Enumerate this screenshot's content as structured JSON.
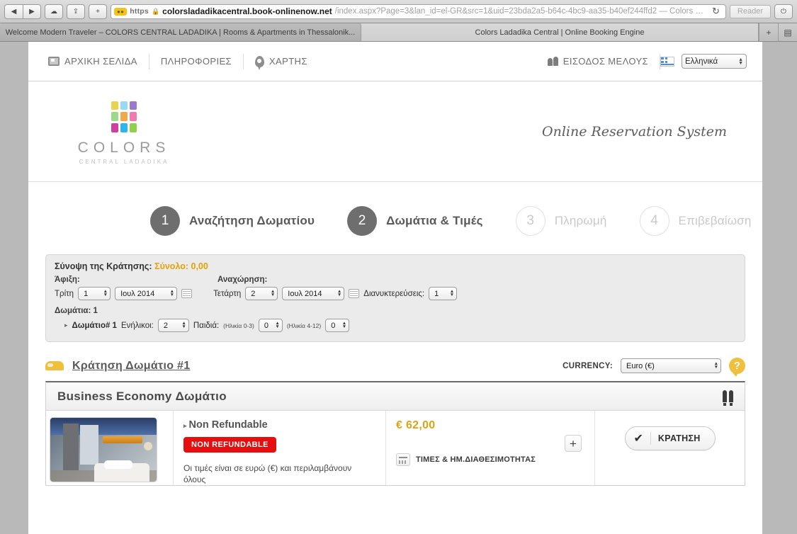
{
  "browser": {
    "back_icon": "◀",
    "forward_icon": "▶",
    "cloud_icon": "☁",
    "share_icon": "⇪",
    "newtab_icon": "+",
    "https_label": "https",
    "lock_icon": "🔒",
    "url_host": "colorsladadikacentral.book-onlinenow.net",
    "url_path": "/index.aspx?Page=3&lan_id=el-GR&src=1&uid=23bda2a5-b64c-4bc9-aa35-b40ef244ffd2 — Colors Ladadika...",
    "reload_icon": "↻",
    "reader_label": "Reader",
    "power_icon": "⏻",
    "tabs": [
      {
        "label": "Welcome Modern Traveler – COLORS CENTRAL LADADIKA | Rooms & Apartments in Thessalonik...",
        "active": false
      },
      {
        "label": "Colors Ladadika Central | Online Booking Engine",
        "active": true
      }
    ],
    "tab_add_icon": "+",
    "tab_list_icon": "▤"
  },
  "topnav": {
    "links": [
      {
        "label": "ΑΡΧΙΚΗ ΣΕΛΙΔΑ",
        "icon": "monitor-icon"
      },
      {
        "label": "ΠΛΗΡΟΦΟΡΙΕΣ",
        "icon": ""
      },
      {
        "label": "ΧΑΡΤΗΣ",
        "icon": "map-pin-icon"
      }
    ],
    "member_login": "ΕΙΣΟΔΟΣ ΜΕΛΟΥΣ",
    "language": "Ελληνικά",
    "flag_icon": "greek-flag-icon"
  },
  "logo": {
    "name": "COLORS",
    "subtitle": "CENTRAL LADADIKA",
    "tagline": "Online Reservation System",
    "tile_colors": [
      "#e8d44d",
      "#9ad9f2",
      "#9b79cf",
      "#9ed98a",
      "#f0a94a",
      "#f07ab0",
      "#d13f9e",
      "#2fb6e8",
      "#8fd24a"
    ]
  },
  "steps": [
    {
      "number": "1",
      "label": "Αναζήτηση Δωματίου",
      "active": true
    },
    {
      "number": "2",
      "label": "Δωμάτια & Τιμές",
      "active": true
    },
    {
      "number": "3",
      "label": "Πληρωμή",
      "active": false
    },
    {
      "number": "4",
      "label": "Επιβεβαίωση",
      "active": false
    }
  ],
  "summary": {
    "title": "Σύνοψη της Κράτησης:",
    "total_label": "Σύνολο: 0,00",
    "arrival_label": "Άφιξη:",
    "departure_label": "Αναχώρηση:",
    "arrival_day_name": "Τρίτη",
    "arrival_day": "1",
    "arrival_month": "Ιουλ 2014",
    "departure_day_name": "Τετάρτη",
    "departure_day": "2",
    "departure_month": "Ιουλ 2014",
    "nights_label": "Διανυκτερεύσεις:",
    "nights": "1",
    "rooms_label": "Δωμάτια: 1",
    "room_number_label": "Δωμάτιο# 1",
    "adults_label": "Ενήλικοι:",
    "adults": "2",
    "children_label": "Παιδιά:",
    "children_age_0_3_label": "(Ηλικία 0-3)",
    "children_age_0_3": "0",
    "children_age_4_12_label": "(Ηλικία 4-12)",
    "children_age_4_12": "0",
    "calendar_icon": "calendar-icon"
  },
  "booking_bar": {
    "title": "Κράτηση Δωμάτιο #1",
    "bed_icon": "bed-icon",
    "currency_label": "CURRENCY:",
    "currency_value": "Euro (€)",
    "help_icon": "?"
  },
  "room": {
    "name": "Business Economy Δωμάτιο",
    "occupancy_icon": "occupancy-two-persons-icon",
    "thumbnail_alt": "room-photo",
    "rate_name": "Non Refundable",
    "rate_tag": "NON REFUNDABLE",
    "rate_note": "Οι τιμές είναι σε ευρώ (€) και περιλαμβάνουν όλους",
    "price": "€ 62,00",
    "plus_label": "+",
    "availability_label": "ΤΙΜΕΣ & ΗΜ.ΔΙΑΘΕΣΙΜΟΤΗΤΑΣ",
    "availability_icon": "calendar-rates-icon",
    "book_button": "ΚΡΑΤΗΣΗ",
    "check_icon": "✔"
  },
  "colors": {
    "accent_gold": "#d9a514",
    "danger_red": "#e60f0f",
    "bed_yellow": "#f0bf3c",
    "step_active": "#6e6e6e"
  }
}
